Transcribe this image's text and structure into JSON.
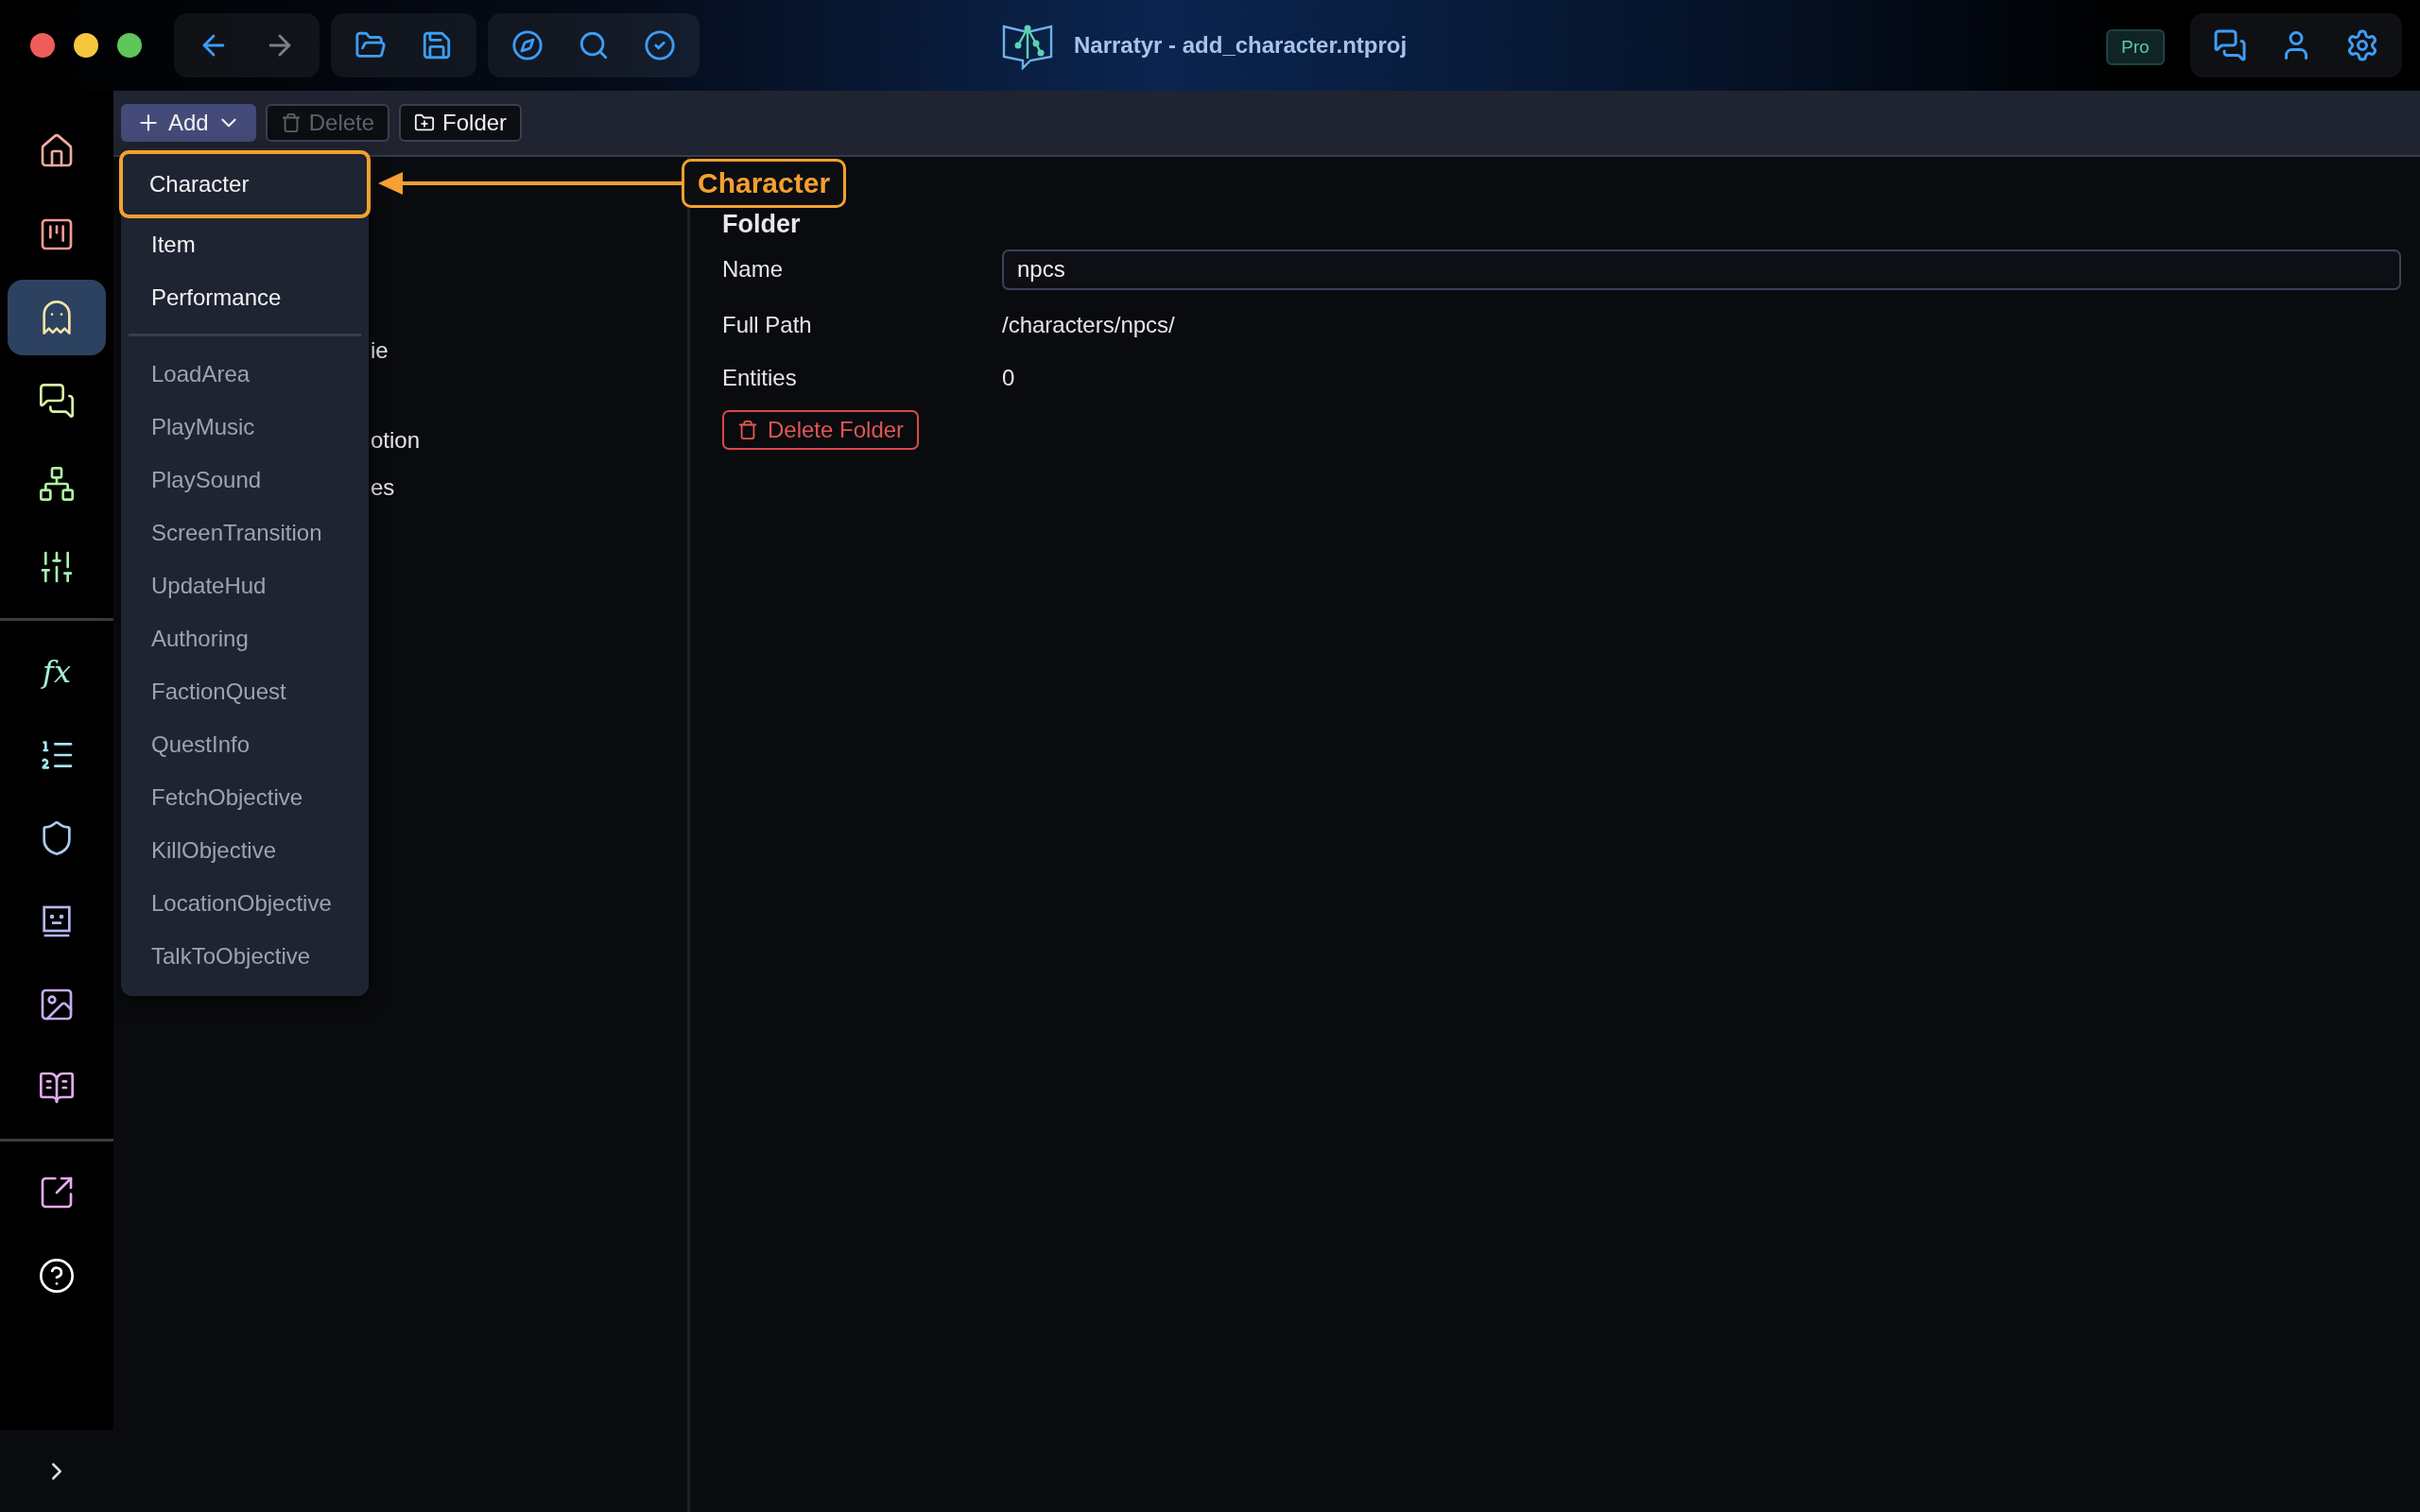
{
  "window": {
    "title": "Narratyr - add_character.ntproj"
  },
  "badge": "Pro",
  "sidebar": {
    "groups": [
      {
        "items": [
          {
            "selected": false
          },
          {
            "selected": false
          },
          {
            "selected": true
          },
          {
            "selected": false
          },
          {
            "selected": false
          },
          {
            "selected": false
          }
        ]
      },
      {
        "items": [
          {
            "selected": false,
            "text": "fx"
          },
          {
            "selected": false
          },
          {
            "selected": false
          },
          {
            "selected": false
          },
          {
            "selected": false
          },
          {
            "selected": false
          }
        ]
      },
      {
        "items": [
          {
            "selected": false
          },
          {
            "selected": false
          }
        ]
      }
    ]
  },
  "toolbar": {
    "buttons": [
      {
        "kind": "add",
        "label": "Add",
        "disabled": false,
        "open": true
      },
      {
        "kind": "delete",
        "label": "Delete",
        "disabled": true
      },
      {
        "kind": "folder",
        "label": "Folder",
        "disabled": false
      }
    ]
  },
  "menu": {
    "sections": [
      {
        "items": [
          {
            "label": "Character",
            "selected": true,
            "disabled": false
          },
          {
            "label": "Item",
            "selected": false,
            "disabled": false
          },
          {
            "label": "Performance",
            "selected": false,
            "disabled": false
          }
        ]
      },
      {
        "items": [
          {
            "label": "LoadArea",
            "selected": false,
            "disabled": true
          },
          {
            "label": "PlayMusic",
            "selected": false,
            "disabled": true
          },
          {
            "label": "PlaySound",
            "selected": false,
            "disabled": true
          },
          {
            "label": "ScreenTransition",
            "selected": false,
            "disabled": true
          },
          {
            "label": "UpdateHud",
            "selected": false,
            "disabled": true
          },
          {
            "label": "Authoring",
            "selected": false,
            "disabled": true
          },
          {
            "label": "FactionQuest",
            "selected": false,
            "disabled": true
          },
          {
            "label": "QuestInfo",
            "selected": false,
            "disabled": true
          },
          {
            "label": "FetchObjective",
            "selected": false,
            "disabled": true
          },
          {
            "label": "KillObjective",
            "selected": false,
            "disabled": true
          },
          {
            "label": "LocationObjective",
            "selected": false,
            "disabled": true
          },
          {
            "label": "TalkToObjective",
            "selected": false,
            "disabled": true
          }
        ]
      }
    ]
  },
  "callout": {
    "label": "Character"
  },
  "tree": {
    "rows": [
      "ie",
      "otion",
      "es"
    ]
  },
  "details": {
    "heading": "Folder",
    "fields": [
      {
        "kind": "input",
        "label": "Name",
        "value": "npcs"
      },
      {
        "kind": "text",
        "label": "Full Path",
        "value": "/characters/npcs/"
      },
      {
        "kind": "text",
        "label": "Entities",
        "value": "0"
      }
    ],
    "action": "Delete Folder"
  }
}
